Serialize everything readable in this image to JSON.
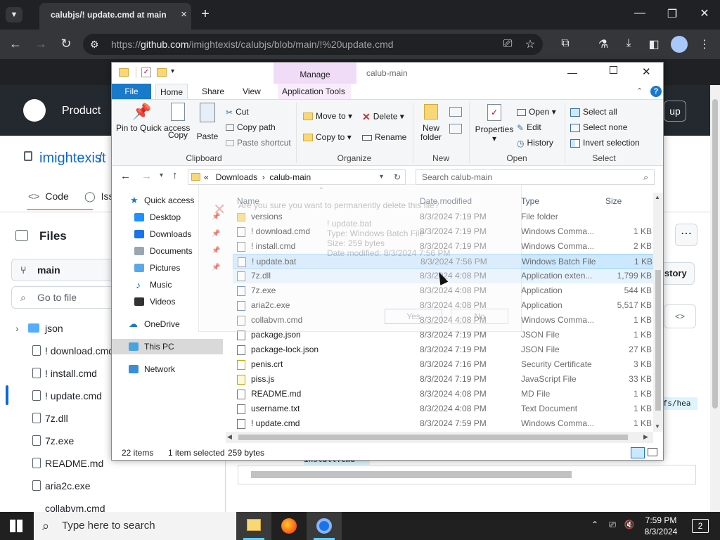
{
  "browser": {
    "tab_title": "calubjs/! update.cmd at main",
    "new_tab": "+",
    "url_prefix": "https://",
    "url_domain": "github.com",
    "url_path": "/imightexist/calubjs/blob/main/!%20update.cmd"
  },
  "github": {
    "product": "Product",
    "owner": "imightexist",
    "separator": "/",
    "signup": "up",
    "tab_code": "Code",
    "tab_issues": "Iss",
    "files_heading": "Files",
    "branch": "main",
    "goto_file_placeholder": "Go to file",
    "history": "istory",
    "code_snip_1": "efs/hea",
    "code_snip_2": "install.cmd",
    "tree": [
      "json",
      "! download.cmd",
      "! install.cmd",
      "! update.cmd",
      "7z.dll",
      "7z.exe",
      "README.md",
      "aria2c.exe",
      "collabvm.cmd"
    ]
  },
  "explorer": {
    "context_tab": "Manage",
    "title": "calub-main",
    "ribbon_tabs": [
      "File",
      "Home",
      "Share",
      "View",
      "Application Tools"
    ],
    "clipboard": {
      "pin": "Pin to Quick access",
      "copy": "Copy",
      "paste": "Paste",
      "cut": "Cut",
      "copy_path": "Copy path",
      "paste_shortcut": "Paste shortcut",
      "label": "Clipboard"
    },
    "organize": {
      "move_to": "Move to",
      "copy_to": "Copy to",
      "delete": "Delete",
      "rename": "Rename",
      "label": "Organize"
    },
    "new": {
      "new_folder": "New folder",
      "label": "New"
    },
    "open": {
      "properties": "Properties",
      "open": "Open",
      "edit": "Edit",
      "history": "History",
      "label": "Open"
    },
    "select": {
      "select_all": "Select all",
      "select_none": "Select none",
      "invert": "Invert selection",
      "label": "Select"
    },
    "address": {
      "overflow": "«",
      "crumb1": "Downloads",
      "sep": "›",
      "crumb2": "calub-main"
    },
    "search_placeholder": "Search calub-main",
    "columns": {
      "name": "Name",
      "date": "Date modified",
      "type": "Type",
      "size": "Size"
    },
    "nav": {
      "quick_access": "Quick access",
      "desktop": "Desktop",
      "downloads": "Downloads",
      "documents": "Documents",
      "pictures": "Pictures",
      "music": "Music",
      "videos": "Videos",
      "onedrive": "OneDrive",
      "this_pc": "This PC",
      "network": "Network"
    },
    "files": [
      {
        "name": "versions",
        "date": "8/3/2024 7:19 PM",
        "type": "File folder",
        "size": ""
      },
      {
        "name": "! download.cmd",
        "date": "8/3/2024 7:19 PM",
        "type": "Windows Comma...",
        "size": "1 KB"
      },
      {
        "name": "! install.cmd",
        "date": "8/3/2024 7:19 PM",
        "type": "Windows Comma...",
        "size": "2 KB"
      },
      {
        "name": "! update.bat",
        "date": "8/3/2024 7:56 PM",
        "type": "Windows Batch File",
        "size": "1 KB"
      },
      {
        "name": "7z.dll",
        "date": "8/3/2024 4:08 PM",
        "type": "Application exten...",
        "size": "1,799 KB"
      },
      {
        "name": "7z.exe",
        "date": "8/3/2024 4:08 PM",
        "type": "Application",
        "size": "544 KB"
      },
      {
        "name": "aria2c.exe",
        "date": "8/3/2024 4:08 PM",
        "type": "Application",
        "size": "5,517 KB"
      },
      {
        "name": "collabvm.cmd",
        "date": "8/3/2024 4:08 PM",
        "type": "Windows Comma...",
        "size": "1 KB"
      },
      {
        "name": "package.json",
        "date": "8/3/2024 7:19 PM",
        "type": "JSON File",
        "size": "1 KB"
      },
      {
        "name": "package-lock.json",
        "date": "8/3/2024 7:19 PM",
        "type": "JSON File",
        "size": "27 KB"
      },
      {
        "name": "penis.crt",
        "date": "8/3/2024 7:16 PM",
        "type": "Security Certificate",
        "size": "3 KB"
      },
      {
        "name": "piss.js",
        "date": "8/3/2024 7:19 PM",
        "type": "JavaScript File",
        "size": "33 KB"
      },
      {
        "name": "README.md",
        "date": "8/3/2024 4:08 PM",
        "type": "MD File",
        "size": "1 KB"
      },
      {
        "name": "username.txt",
        "date": "8/3/2024 4:08 PM",
        "type": "Text Document",
        "size": "1 KB"
      },
      {
        "name": "! update.cmd",
        "date": "8/3/2024 7:59 PM",
        "type": "Windows Comma...",
        "size": "1 KB"
      }
    ],
    "status": {
      "items": "22 items",
      "selected": "1 item selected",
      "bytes": "259 bytes"
    }
  },
  "ghost_dialog": {
    "question": "Are you sure you want to permanently delete this file?",
    "file": "! update.bat",
    "type": "Type: Windows Batch File",
    "size": "Size: 259 bytes",
    "modified": "Date modified: 8/3/2024 7:56 PM",
    "yes": "Yes",
    "no": "No"
  },
  "taskbar": {
    "search_placeholder": "Type here to search",
    "time": "7:59 PM",
    "date": "8/3/2024",
    "notifications": "2"
  },
  "colors": {
    "selection": "#cce8ff",
    "manage_tab": "#f0dcf7",
    "github_header": "#24292f",
    "taskbar": "#202020"
  }
}
